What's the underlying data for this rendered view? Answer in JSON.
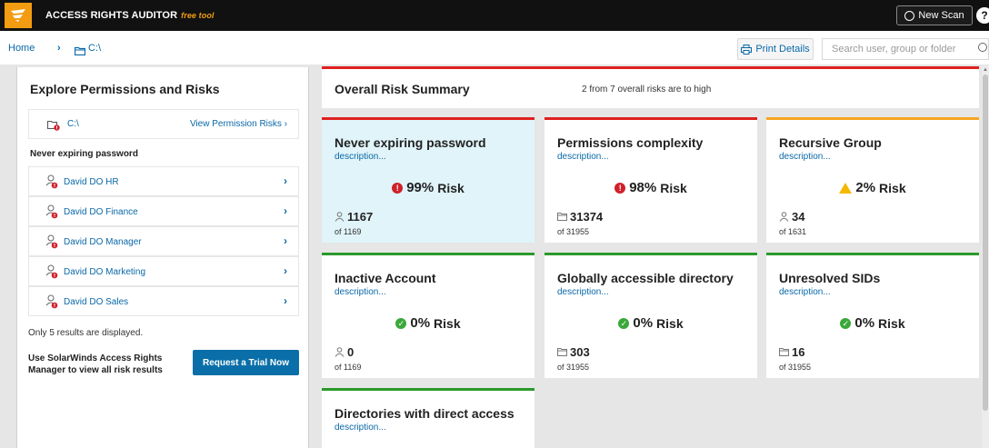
{
  "header": {
    "app_title": "ACCESS RIGHTS AUDITOR",
    "free_label": "free tool",
    "new_scan_label": "New Scan",
    "help_label": "?"
  },
  "breadcrumb": {
    "home": "Home",
    "separator": "›",
    "path": "C:\\"
  },
  "toolbar": {
    "print_label": "Print Details",
    "search_placeholder": "Search user, group or folder"
  },
  "left_panel": {
    "title": "Explore Permissions and Risks",
    "folder_path": "C:\\",
    "view_risks_label": "View Permission Risks ›",
    "section_label": "Never expiring password",
    "users": [
      {
        "name": "David DO HR"
      },
      {
        "name": "David DO Finance"
      },
      {
        "name": "David DO Manager"
      },
      {
        "name": "David DO Marketing"
      },
      {
        "name": "David DO Sales"
      }
    ],
    "note": "Only 5 results are displayed.",
    "upsell": "Use SolarWinds Access Rights Manager to view all risk results",
    "trial_button": "Request a Trial Now"
  },
  "summary": {
    "title": "Overall Risk Summary",
    "text": "2 from 7 overall risks are to high"
  },
  "cards": [
    {
      "title": "Never expiring password",
      "desc": "description...",
      "risk": "99%",
      "risk_suffix": " Risk",
      "status": "high",
      "count": "1167",
      "of": "of 1169",
      "count_icon": "user-icon"
    },
    {
      "title": "Permissions complexity",
      "desc": "description...",
      "risk": "98%",
      "risk_suffix": " Risk",
      "status": "high",
      "count": "31374",
      "of": "of 31955",
      "count_icon": "folder-icon"
    },
    {
      "title": "Recursive Group",
      "desc": "description...",
      "risk": "2%",
      "risk_suffix": " Risk",
      "status": "warning",
      "count": "34",
      "of": "of 1631",
      "count_icon": "user-icon"
    },
    {
      "title": "Inactive Account",
      "desc": "description...",
      "risk": "0%",
      "risk_suffix": " Risk",
      "status": "ok",
      "count": "0",
      "of": "of 1169",
      "count_icon": "user-icon"
    },
    {
      "title": "Globally accessible directory",
      "desc": "description...",
      "risk": "0%",
      "risk_suffix": " Risk",
      "status": "ok",
      "count": "303",
      "of": "of 31955",
      "count_icon": "folder-icon"
    },
    {
      "title": "Unresolved SIDs",
      "desc": "description...",
      "risk": "0%",
      "risk_suffix": " Risk",
      "status": "ok",
      "count": "16",
      "of": "of 31955",
      "count_icon": "folder-icon"
    },
    {
      "title": "Directories with direct access",
      "desc": "description...",
      "status": "ok"
    }
  ],
  "colors": {
    "high": "#e02020",
    "warning": "#f5a623",
    "ok": "#2a9a2a",
    "accent": "#0a68a8",
    "brand": "#f39c12"
  }
}
